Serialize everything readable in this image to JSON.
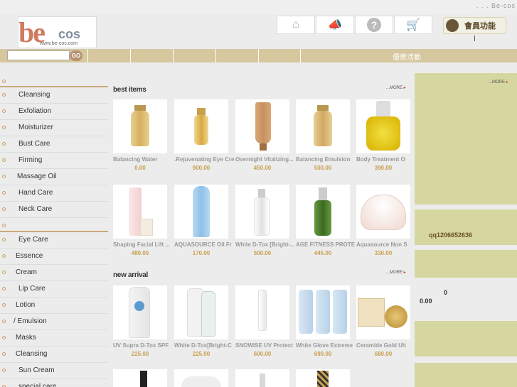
{
  "topbar": {
    "text": ".    .    .    Be-cos"
  },
  "logo": {
    "big": "be",
    "small": "cos",
    "url": "www.be-cos.com"
  },
  "nav": {
    "icons": [
      "home-icon",
      "megaphone-icon",
      "help-icon",
      "cart-icon"
    ],
    "member_label": "會員功能"
  },
  "search": {
    "value": "",
    "go_label": "GO"
  },
  "menu": {
    "promo_label": "優惠活動"
  },
  "sidebar": {
    "groups": [
      {
        "items": [
          "Cleansing",
          "Exfoliation",
          "Moisturizer",
          "Bust Care",
          "Firming",
          "Massage Oil",
          "Hand Care",
          "Neck Care"
        ]
      },
      {
        "items": [
          "Eye Care",
          "Essence",
          "Cream",
          "Lip Care",
          "Lotion",
          "/  Emulsion",
          "Masks",
          "Cleansing",
          "Sun Cream",
          "special care"
        ]
      }
    ]
  },
  "best_items": {
    "title": "best items",
    "more_label": "...MORE",
    "rows": [
      [
        {
          "name": "Balancing Water",
          "price": "0.00"
        },
        {
          "name": ".Rejuvenating Eye Cre",
          "price": "900.00"
        },
        {
          "name": "Overnight Vitalizing...",
          "price": "450.00"
        },
        {
          "name": "Balancing Emulsion",
          "price": "500.00"
        },
        {
          "name": "Body Treatment O",
          "price": "390.00"
        }
      ],
      [
        {
          "name": "Shaping Facial Lift ...",
          "price": "480.00"
        },
        {
          "name": "AQUASOURCE Oil Fr",
          "price": "170.00"
        },
        {
          "name": "White D-Tox [Bright-...",
          "price": "500.00"
        },
        {
          "name": "AGE FITNESS PROTE",
          "price": "445.00"
        },
        {
          "name": "Aquasource Non S",
          "price": "330.00"
        }
      ]
    ]
  },
  "new_arrival": {
    "title": "new arrival",
    "more_label": "...MORE",
    "rows": [
      [
        {
          "name": "UV Supra D-Tox SPF",
          "price": "225.00"
        },
        {
          "name": "White D-Tox[Bright-C",
          "price": "225.00"
        },
        {
          "name": "SNOWISE UV Protect",
          "price": "600.00"
        },
        {
          "name": "White Glove Extreme",
          "price": "690.00"
        },
        {
          "name": "Ceramide Gold Ult",
          "price": "680.00"
        }
      ]
    ]
  },
  "right_panel": {
    "more_label": "...MORE",
    "qq": "qq1206652636",
    "cart_count": "0",
    "cart_total": "0.00"
  },
  "colors": {
    "menubar": "#d6c79e",
    "panel": "#d6d6a0",
    "price": "#c8a050"
  }
}
